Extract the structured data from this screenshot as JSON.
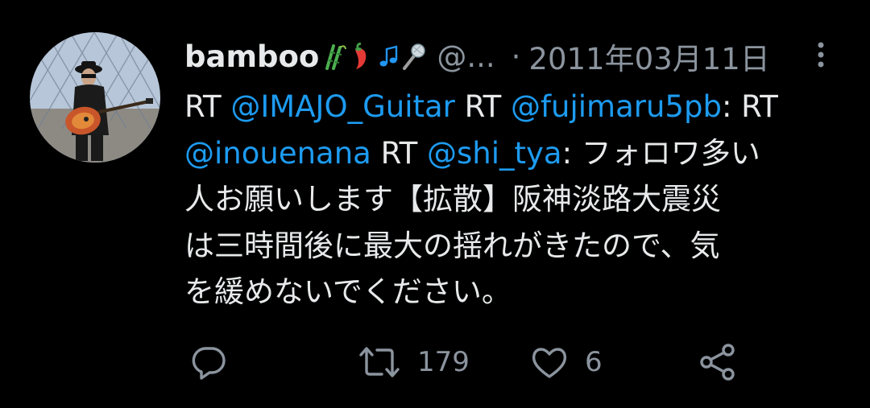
{
  "tweet": {
    "display_name": "bamboo",
    "handle": "@...",
    "separator": "·",
    "date": "2011年03月11日",
    "text_lines": [
      [
        "RT ",
        "@IMAJO_Guitar",
        " RT ",
        "@fujimaru5pb",
        ": RT"
      ],
      [
        "@inouenana",
        " RT ",
        "@shi_tya",
        ": フォロワ多い"
      ],
      [
        "人お願いします【拡散】阪神淡路大震災"
      ],
      [
        "は三時間後に最大の揺れがきたので、気"
      ],
      [
        "を緩めないでください。"
      ]
    ]
  },
  "actions": {
    "reply": {
      "icon": "reply-icon"
    },
    "retweet": {
      "icon": "retweet-icon",
      "count": "179"
    },
    "like": {
      "icon": "heart-icon",
      "count": "6"
    },
    "share": {
      "icon": "share-icon"
    }
  },
  "colors": {
    "background": "#000000",
    "text": "#e7e9ea",
    "secondary": "#8b949e",
    "mention": "#1d9bf0"
  }
}
